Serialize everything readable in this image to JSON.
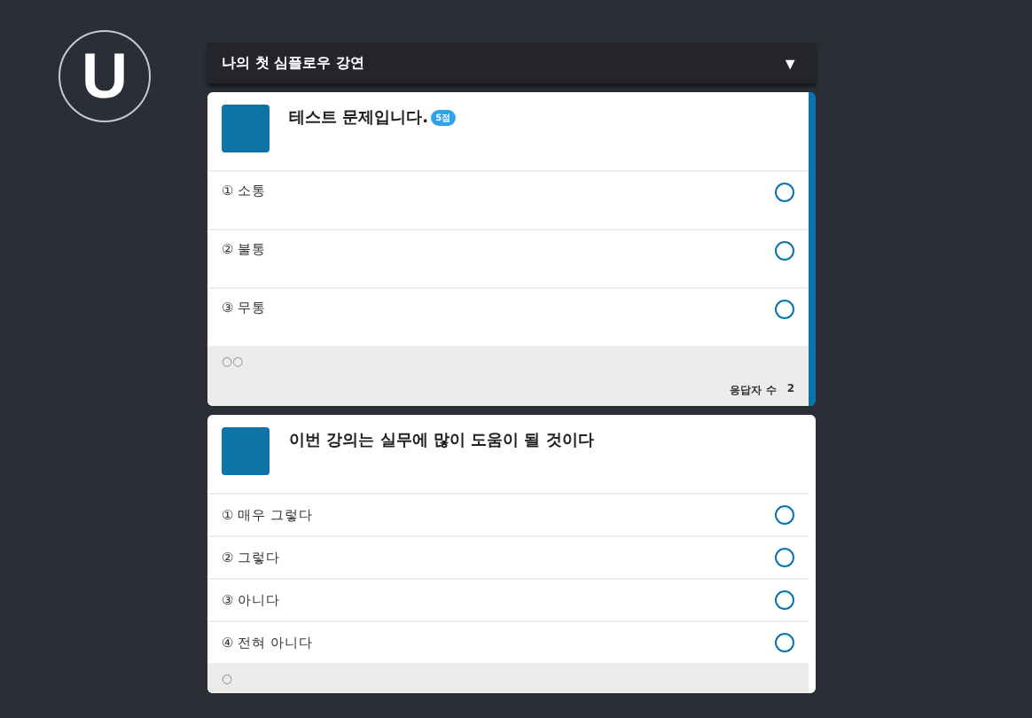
{
  "logo": {
    "letter": "U"
  },
  "header": {
    "title": "나의 첫 심플로우 강연",
    "toggle": "▼"
  },
  "questions": [
    {
      "title": "테스트 문제입니다.",
      "badge": "5점",
      "active": true,
      "kind": "tall",
      "options": [
        {
          "label": "① 소통",
          "selected": false
        },
        {
          "label": "② 불통",
          "selected": false
        },
        {
          "label": "③ 무통",
          "selected": false
        }
      ],
      "footer": {
        "dots": "○○",
        "respondents_label": "응답자 수",
        "respondents": "2"
      }
    },
    {
      "title": "이번 강의는 실무에 많이 도움이 될 것이다",
      "active": false,
      "kind": "compact",
      "options": [
        {
          "label": "① 매우 그렇다",
          "selected": false
        },
        {
          "label": "② 그렇다",
          "selected": false
        },
        {
          "label": "③ 아니다",
          "selected": false
        },
        {
          "label": "④ 전혀 아니다",
          "selected": false
        }
      ],
      "footer": {
        "dots": "○"
      }
    }
  ]
}
